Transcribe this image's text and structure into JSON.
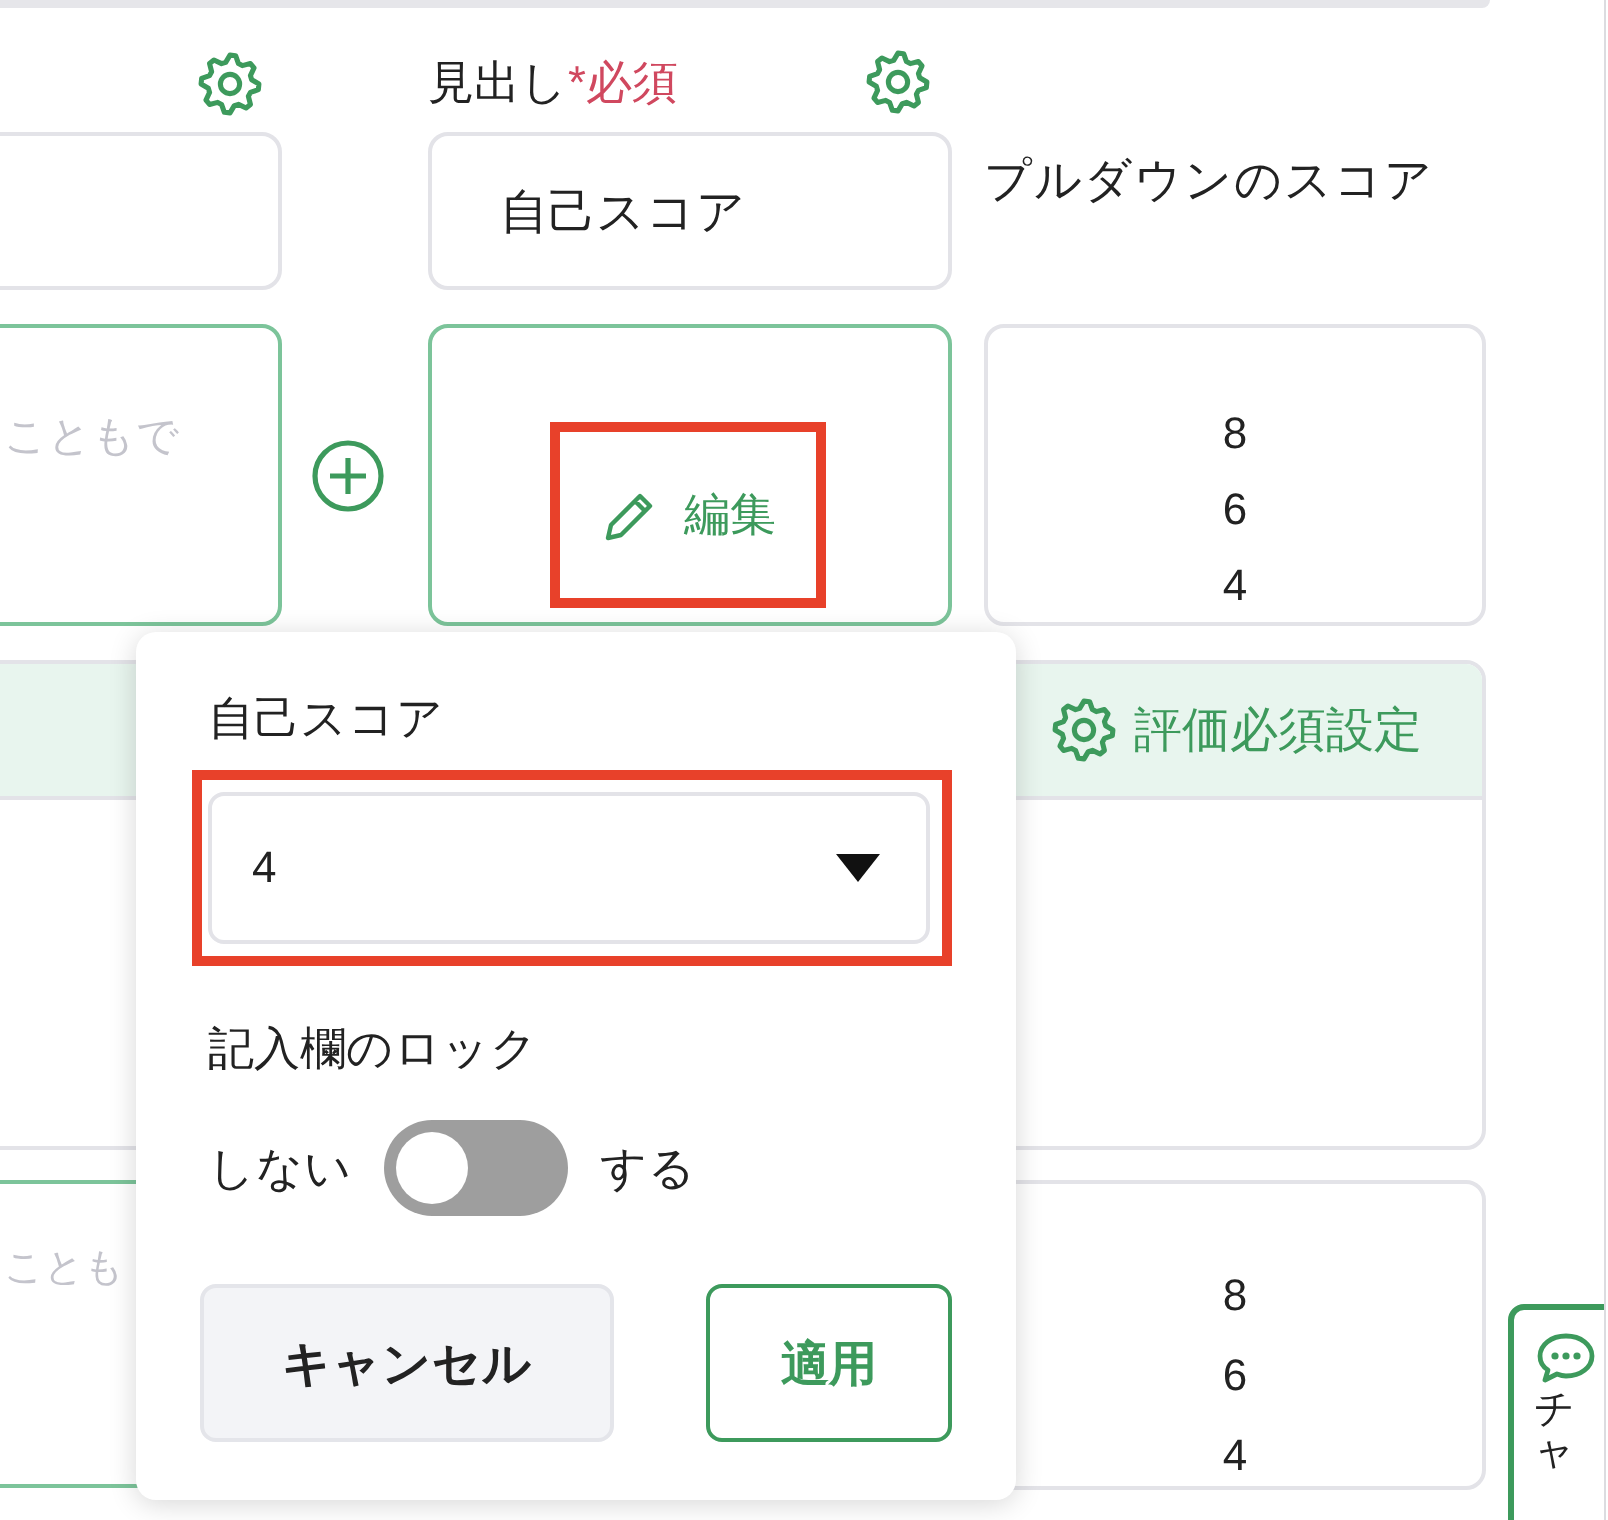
{
  "heading_field": {
    "label": "見出し",
    "required_mark": "*必須",
    "value": "自己スコア"
  },
  "pulldown_label": "プルダウンのスコア",
  "answer_row": {
    "placeholder": "こともで",
    "edit_button": {
      "label": "編集",
      "highlighted": true
    },
    "scores": [
      "8",
      "6",
      "4"
    ]
  },
  "panel": {
    "header": "評価必須設定"
  },
  "bottom_row": {
    "placeholder": "ことも",
    "scores": [
      "8",
      "6",
      "4"
    ]
  },
  "popover": {
    "field_label": "自己スコア",
    "select": {
      "value": "4",
      "highlighted": true
    },
    "lock_label": "記入欄のロック",
    "toggle": {
      "off_label": "しない",
      "on_label": "する",
      "on": false
    },
    "buttons": [
      {
        "label": "キャンセル",
        "kind": "secondary"
      },
      {
        "label": "適用",
        "kind": "primary"
      }
    ]
  },
  "chat_tab": {
    "label": "チャ"
  }
}
